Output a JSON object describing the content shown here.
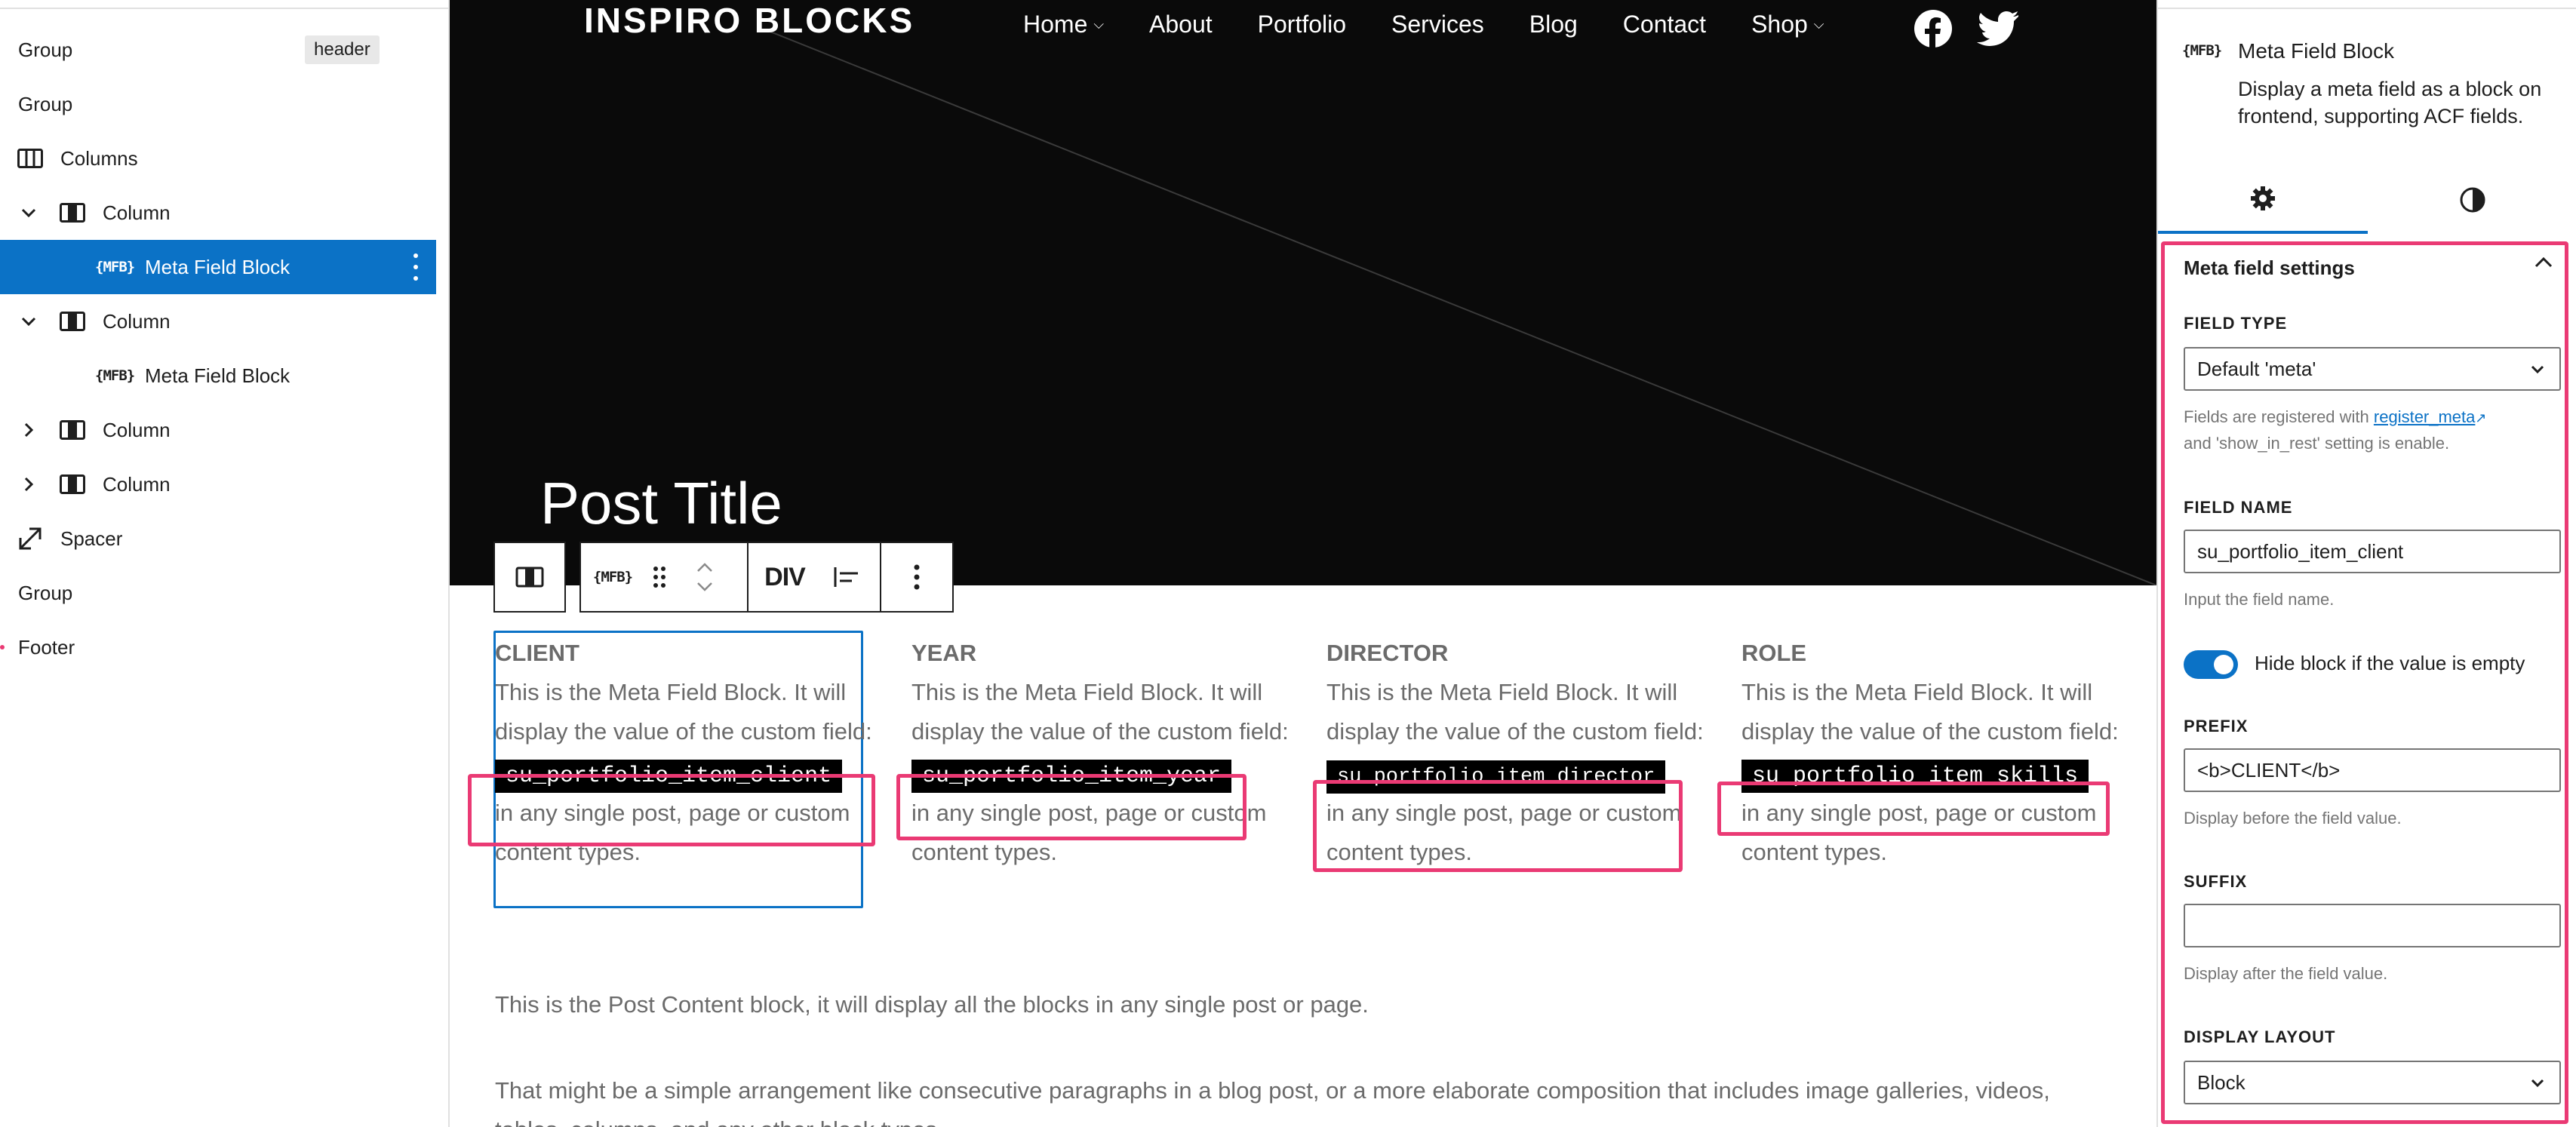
{
  "list_view": {
    "items": [
      {
        "label": "Group",
        "badge": "header"
      },
      {
        "label": "Group"
      },
      {
        "label": "Columns"
      },
      {
        "label": "Column"
      },
      {
        "label": "Meta Field Block",
        "icon_text": "{MFB}"
      },
      {
        "label": "Column"
      },
      {
        "label": "Meta Field Block",
        "icon_text": "{MFB}"
      },
      {
        "label": "Column"
      },
      {
        "label": "Column"
      },
      {
        "label": "Spacer"
      },
      {
        "label": "Group"
      },
      {
        "label": "Footer"
      }
    ]
  },
  "site": {
    "title": "INSPIRO BLOCKS",
    "nav": [
      "Home",
      "About",
      "Portfolio",
      "Services",
      "Blog",
      "Contact",
      "Shop"
    ],
    "post_title": "Post Title"
  },
  "toolbar": {
    "mfb_icon_text": "{MFB}",
    "tag_label": "DIV"
  },
  "columns": [
    {
      "heading": "CLIENT",
      "text_before": "This is the Meta Field Block. It will display the value of the custom field:",
      "field": "su_portfolio_item_client",
      "text_after": "in any single post, page or custom content types."
    },
    {
      "heading": "YEAR",
      "text_before": "This is the Meta Field Block. It will display the value of the custom field:",
      "field": "su_portfolio_item_year",
      "text_after": "in any single post, page or custom content types."
    },
    {
      "heading": "DIRECTOR",
      "text_before": "This is the Meta Field Block. It will display the value of the custom field:",
      "field": "su_portfolio_item_director",
      "text_after": "in any single post, page or custom content types."
    },
    {
      "heading": "ROLE",
      "text_before": "This is the Meta Field Block. It will display the value of the custom field:",
      "field": "su_portfolio_item_skills",
      "text_after": "in any single post, page or custom content types."
    }
  ],
  "content": {
    "p1": "This is the Post Content block, it will display all the blocks in any single post or page.",
    "p2": "That might be a simple arrangement like consecutive paragraphs in a blog post, or a more elaborate composition that includes image galleries, videos,",
    "p3": "tables, columns, and any other block types."
  },
  "sidebar": {
    "block_icon_text": "{MFB}",
    "block_title": "Meta Field Block",
    "block_description": "Display a meta field as a block on frontend, supporting ACF fields.",
    "panel_title": "Meta field settings",
    "field_type_label": "FIELD TYPE",
    "field_type_value": "Default 'meta'",
    "field_type_help_prefix": "Fields are registered with ",
    "field_type_help_link": "register_meta",
    "field_type_help_suffix": "and 'show_in_rest' setting is enable.",
    "field_name_label": "FIELD NAME",
    "field_name_value": "su_portfolio_item_client",
    "field_name_help": "Input the field name.",
    "hide_toggle_label": "Hide block if the value is empty",
    "hide_toggle_on": true,
    "prefix_label": "PREFIX",
    "prefix_value": "<b>CLIENT</b>",
    "prefix_help": "Display before the field value.",
    "suffix_label": "SUFFIX",
    "suffix_value": "",
    "suffix_help": "Display after the field value.",
    "display_layout_label": "DISPLAY LAYOUT",
    "display_layout_value": "Block"
  },
  "colors": {
    "accent": "#0b72c6",
    "highlight": "#ea3a74",
    "hero_bg": "#0a0a0a"
  }
}
